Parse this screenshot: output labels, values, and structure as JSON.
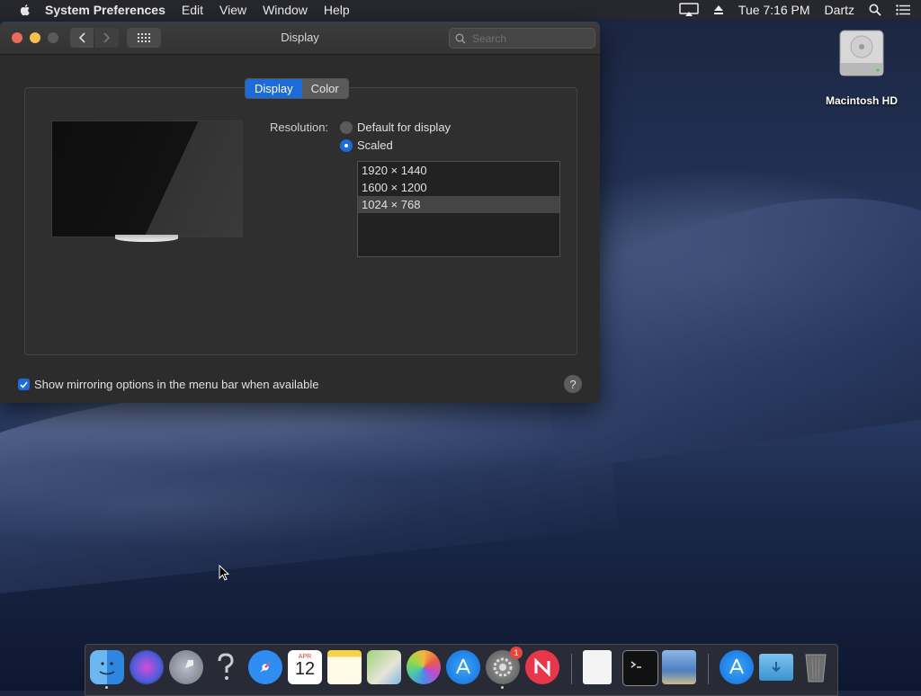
{
  "menubar": {
    "app_name": "System Preferences",
    "items": [
      "Edit",
      "View",
      "Window",
      "Help"
    ],
    "clock": "Tue 7:16 PM",
    "user": "Dartz"
  },
  "desktop": {
    "hd_label": "Macintosh HD"
  },
  "window": {
    "title": "Display",
    "search_placeholder": "Search",
    "tabs": [
      {
        "label": "Display",
        "active": true
      },
      {
        "label": "Color",
        "active": false
      }
    ],
    "resolution_label": "Resolution:",
    "options": [
      {
        "label": "Default for display",
        "selected": false
      },
      {
        "label": "Scaled",
        "selected": true
      }
    ],
    "resolutions": [
      {
        "label": "1920 × 1440",
        "selected": false
      },
      {
        "label": "1600 × 1200",
        "selected": false
      },
      {
        "label": "1024 × 768",
        "selected": true
      }
    ],
    "mirroring_checkbox": {
      "label": "Show mirroring options in the menu bar when available",
      "checked": true
    },
    "help_label": "?"
  },
  "dock": {
    "calendar_month": "APR",
    "calendar_day": "12",
    "badge_count": "1",
    "apps": [
      "finder-icon",
      "siri-icon",
      "launchpad-icon",
      "help-icon",
      "safari-icon",
      "calendar-icon",
      "notes-icon",
      "maps-icon",
      "photos-icon",
      "app-store-icon",
      "system-preferences-icon",
      "news-icon",
      "textedit-icon",
      "terminal-icon",
      "preview-icon",
      "app-store-download-icon",
      "downloads-folder-icon",
      "trash-icon"
    ]
  },
  "colors": {
    "accent": "#1d6bd9",
    "window_bg": "#2c2c2c"
  }
}
